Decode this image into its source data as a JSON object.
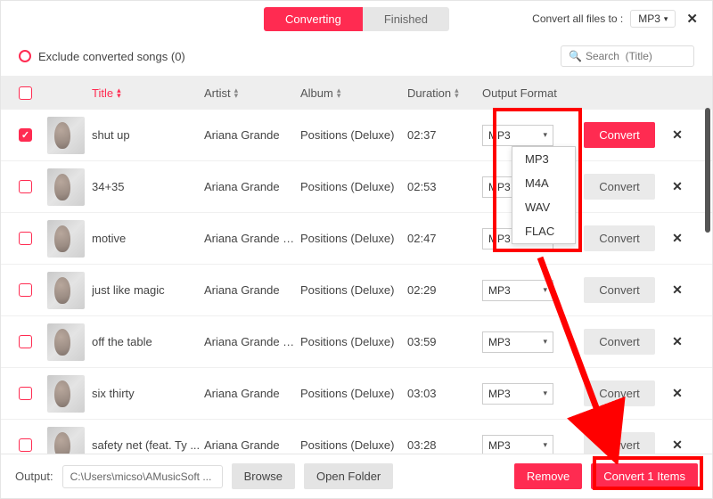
{
  "tabs": {
    "converting": "Converting",
    "finished": "Finished"
  },
  "convert_all": {
    "label": "Convert all files to :",
    "format": "MP3"
  },
  "exclude": {
    "label": "Exclude converted songs (0)"
  },
  "search": {
    "placeholder": "Search  (Title)"
  },
  "columns": {
    "title": "Title",
    "artist": "Artist",
    "album": "Album",
    "duration": "Duration",
    "output_format": "Output Format"
  },
  "dropdown_options": [
    "MP3",
    "M4A",
    "WAV",
    "FLAC"
  ],
  "rows": [
    {
      "checked": true,
      "title": "shut up",
      "artist": "Ariana Grande",
      "album": "Positions (Deluxe)",
      "duration": "02:37",
      "format": "MP3",
      "active": true
    },
    {
      "checked": false,
      "title": "34+35",
      "artist": "Ariana Grande",
      "album": "Positions (Deluxe)",
      "duration": "02:53",
      "format": "MP3",
      "active": false
    },
    {
      "checked": false,
      "title": "motive",
      "artist": "Ariana Grande & ...",
      "album": "Positions (Deluxe)",
      "duration": "02:47",
      "format": "MP3",
      "active": false
    },
    {
      "checked": false,
      "title": "just like magic",
      "artist": "Ariana Grande",
      "album": "Positions (Deluxe)",
      "duration": "02:29",
      "format": "MP3",
      "active": false
    },
    {
      "checked": false,
      "title": "off the table",
      "artist": "Ariana Grande & ...",
      "album": "Positions (Deluxe)",
      "duration": "03:59",
      "format": "MP3",
      "active": false
    },
    {
      "checked": false,
      "title": "six thirty",
      "artist": "Ariana Grande",
      "album": "Positions (Deluxe)",
      "duration": "03:03",
      "format": "MP3",
      "active": false
    },
    {
      "checked": false,
      "title": "safety net (feat. Ty ...",
      "artist": "Ariana Grande",
      "album": "Positions (Deluxe)",
      "duration": "03:28",
      "format": "MP3",
      "active": false
    }
  ],
  "row_button": "Convert",
  "footer": {
    "output_label": "Output:",
    "path": "C:\\Users\\micso\\AMusicSoft ...",
    "browse": "Browse",
    "open_folder": "Open Folder",
    "remove": "Remove",
    "convert_n": "Convert 1 Items"
  }
}
